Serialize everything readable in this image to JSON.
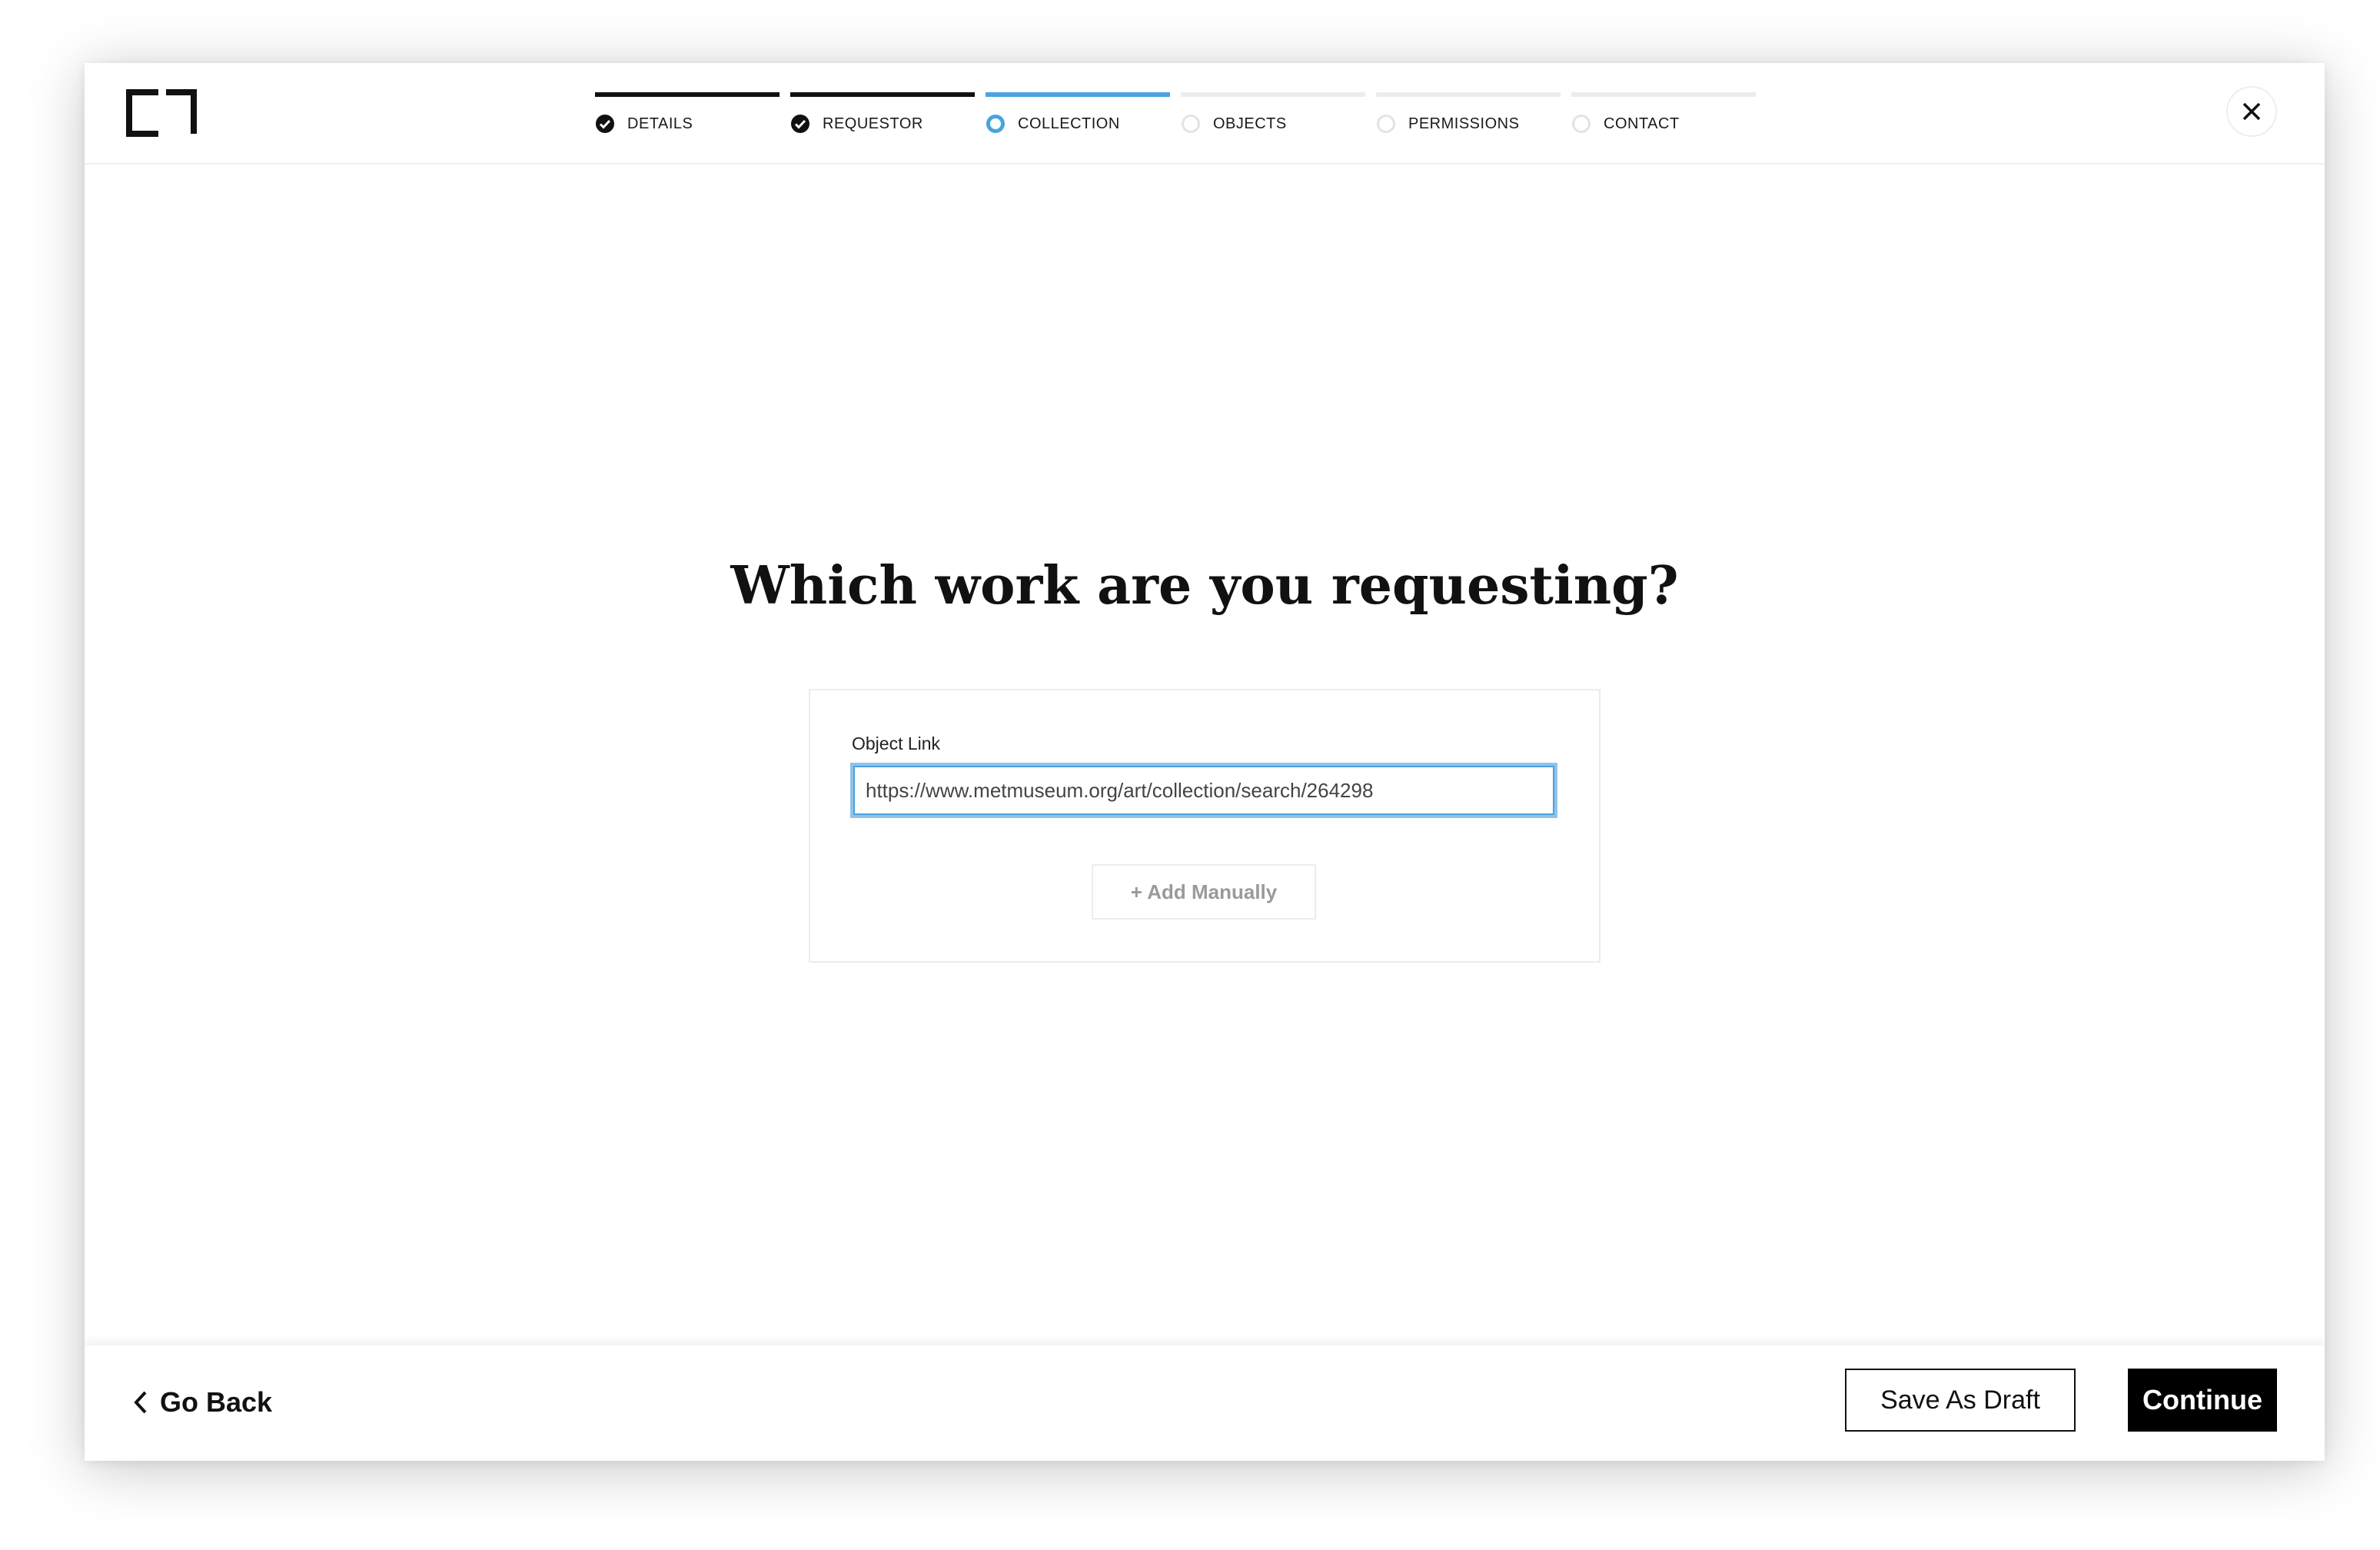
{
  "logo": {
    "icon": "brand-logo-icon"
  },
  "steps": [
    {
      "label": "DETAILS",
      "state": "done"
    },
    {
      "label": "REQUESTOR",
      "state": "done"
    },
    {
      "label": "COLLECTION",
      "state": "current"
    },
    {
      "label": "OBJECTS",
      "state": "upcoming"
    },
    {
      "label": "PERMISSIONS",
      "state": "upcoming"
    },
    {
      "label": "CONTACT",
      "state": "upcoming"
    }
  ],
  "main": {
    "title": "Which work are you requesting?",
    "object_link": {
      "label": "Object Link",
      "value": "https://www.metmuseum.org/art/collection/search/264298"
    },
    "add_manually_label": "+ Add Manually"
  },
  "footer": {
    "go_back_label": "Go Back",
    "save_draft_label": "Save As Draft",
    "continue_label": "Continue"
  },
  "colors": {
    "accent": "#4aa3df",
    "done": "#111111",
    "upcoming": "#ececec"
  }
}
